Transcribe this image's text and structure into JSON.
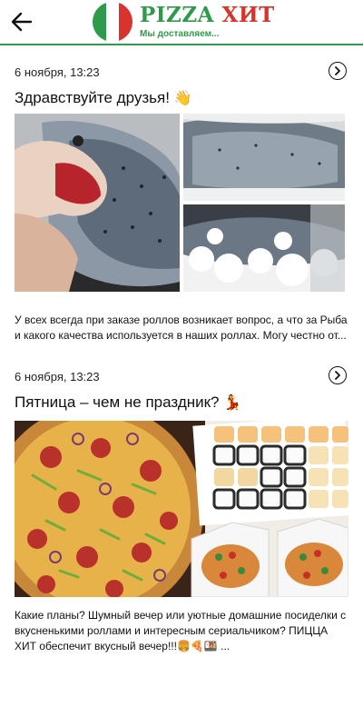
{
  "header": {
    "back_icon": "arrow-left-icon",
    "logo_word1": "PIZZA",
    "logo_word2": "ХИТ",
    "logo_tagline": "Мы доставляем...",
    "colors": {
      "brand_green": "#2f9a4a",
      "brand_red": "#d6342c"
    }
  },
  "posts": [
    {
      "date": "6 ноября, 13:23",
      "title": "Здравствуйте друзья!",
      "title_emoji": "👋",
      "text": "У всех всегда при заказе роллов возникает вопрос, а что за Рыба и какого качества используется в наших роллах. Могу честно от...",
      "open_icon": "chevron-right-circle-icon",
      "images": [
        "salmon-in-hand-photo",
        "salmon-on-ice-photo",
        "salmon-fillet-on-ice-photo"
      ]
    },
    {
      "date": "6 ноября, 13:23",
      "title": "Пятница – чем не праздник?",
      "title_emoji": "💃",
      "text": "Какие планы? Шумный вечер или уютные домашние посиделки с вкусненькими роллами и интересным сериальчиком? ПИЦЦА ХИТ обеспечит вкусный вечер!!!🍔🍕🍱 ...",
      "open_icon": "chevron-right-circle-icon",
      "images": [
        "pizza-with-pepperoni-photo",
        "sushi-rolls-set-photo"
      ]
    }
  ]
}
